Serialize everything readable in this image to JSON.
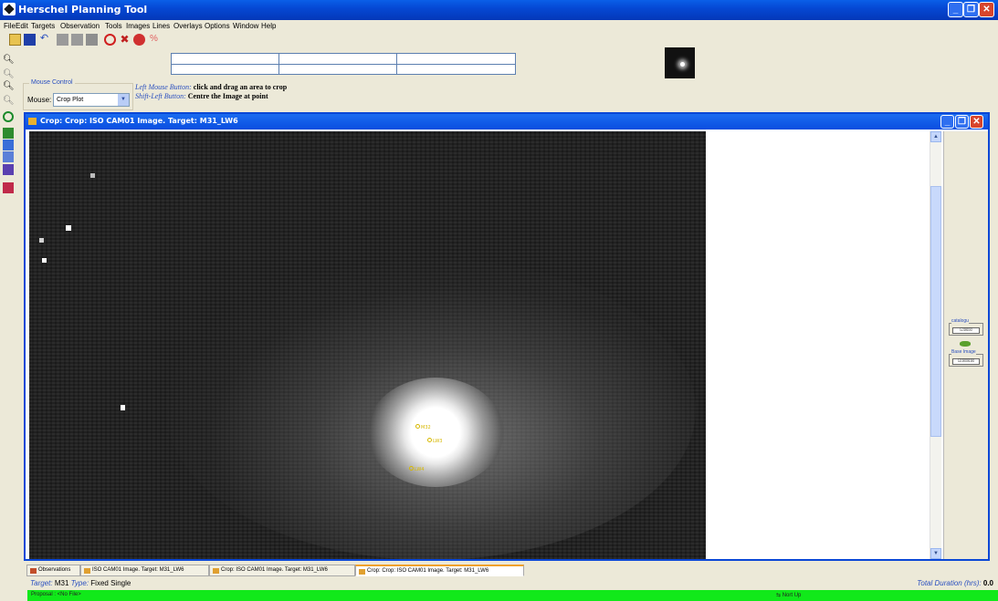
{
  "window": {
    "title": "Herschel Planning Tool"
  },
  "menu": [
    "File",
    "Edit",
    "Targets",
    "Observation",
    "Tools",
    "Images",
    "Lines",
    "Overlays",
    "Options",
    "Window",
    "Help"
  ],
  "mouse_control": {
    "legend": "Mouse Control",
    "label": "Mouse:",
    "selected": "Crop Plot",
    "left_button_label": "Left Mouse Button:",
    "left_button_action": "click and drag an area to crop",
    "shift_left_label": "Shift-Left Button:",
    "shift_left_action": "Centre the Image at point"
  },
  "inner_window": {
    "title": "Crop: Crop: ISO CAM01 Image. Target: M31_LW6"
  },
  "overlay_labels": [
    "M32",
    "LW3",
    "LW4"
  ],
  "right_panel": {
    "catalogue_label": "catalogu",
    "base_image_label": "Base Image"
  },
  "tabs": [
    "Observations",
    "ISO CAM01 Image. Target: M31_LW6",
    "Crop: ISO CAM01 Image. Target: M31_LW6",
    "Crop: Crop: ISO CAM01 Image. Target: M31_LW6"
  ],
  "status": {
    "target_label": "Target:",
    "target_value": "M31",
    "type_label": "Type:",
    "type_value": "Fixed Single",
    "duration_label": "Total Duration (hrs):",
    "duration_value": "0.0",
    "proposal": "Proposal : <No File>",
    "north_up": "Nort Up"
  },
  "colors": {
    "accent": "#0a4de0",
    "status_green": "#11e91a",
    "overlay": "#d7b800"
  }
}
